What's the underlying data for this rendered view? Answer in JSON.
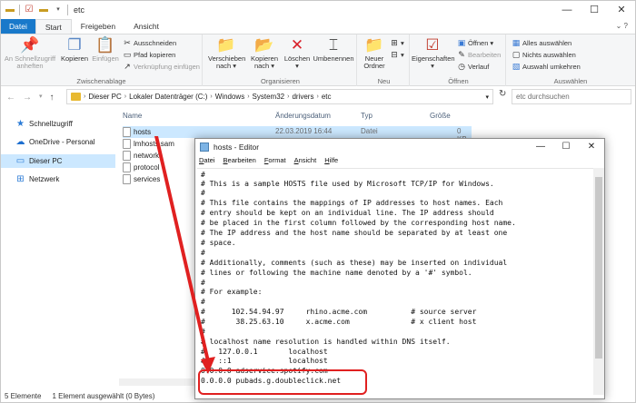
{
  "explorer": {
    "title": "etc",
    "tabs": [
      "Datei",
      "Start",
      "Freigeben",
      "Ansicht"
    ],
    "ribbon": {
      "clipboard": {
        "label": "Zwischenablage",
        "quick_access": "An Schnellzugriff anheften",
        "copy": "Kopieren",
        "paste": "Einfügen",
        "cut": "Ausschneiden",
        "copy_path": "Pfad kopieren",
        "paste_link": "Verknüpfung einfügen"
      },
      "organize": {
        "label": "Organisieren",
        "move_to": "Verschieben nach",
        "copy_to": "Kopieren nach",
        "delete": "Löschen",
        "rename": "Umbenennen"
      },
      "new": {
        "label": "Neu",
        "new_folder": "Neuer Ordner"
      },
      "open": {
        "label": "Öffnen",
        "properties": "Eigenschaften",
        "open": "Öffnen",
        "edit": "Bearbeiten",
        "history": "Verlauf"
      },
      "select": {
        "label": "Auswählen",
        "select_all": "Alles auswählen",
        "select_none": "Nichts auswählen",
        "invert": "Auswahl umkehren"
      }
    },
    "address": {
      "crumbs": [
        "Dieser PC",
        "Lokaler Datenträger (C:)",
        "Windows",
        "System32",
        "drivers",
        "etc"
      ],
      "search_placeholder": "etc durchsuchen"
    },
    "nav": {
      "quick_access": "Schnellzugriff",
      "onedrive": "OneDrive - Personal",
      "this_pc": "Dieser PC",
      "network": "Netzwerk"
    },
    "columns": {
      "name": "Name",
      "date": "Änderungsdatum",
      "type": "Typ",
      "size": "Größe"
    },
    "files": [
      {
        "name": "hosts",
        "date": "22.03.2019 16:44",
        "type": "Datei",
        "size": "0 KB"
      },
      {
        "name": "lmhosts.sam"
      },
      {
        "name": "networks"
      },
      {
        "name": "protocol"
      },
      {
        "name": "services"
      }
    ],
    "status": {
      "count": "5 Elemente",
      "selected": "1 Element ausgewählt (0 Bytes)"
    }
  },
  "notepad": {
    "title": "hosts - Editor",
    "menu": [
      "Datei",
      "Bearbeiten",
      "Format",
      "Ansicht",
      "Hilfe"
    ],
    "lines": [
      "#",
      "# This is a sample HOSTS file used by Microsoft TCP/IP for Windows.",
      "#",
      "# This file contains the mappings of IP addresses to host names. Each",
      "# entry should be kept on an individual line. The IP address should",
      "# be placed in the first column followed by the corresponding host name.",
      "# The IP address and the host name should be separated by at least one",
      "# space.",
      "#",
      "# Additionally, comments (such as these) may be inserted on individual",
      "# lines or following the machine name denoted by a '#' symbol.",
      "#",
      "# For example:",
      "#",
      "#      102.54.94.97     rhino.acme.com          # source server",
      "#       38.25.63.10     x.acme.com              # x client host",
      "#",
      "# localhost name resolution is handled within DNS itself.",
      "#   127.0.0.1       localhost",
      "#   ::1             localhost",
      "0.0.0.0 adservice.spotify.com",
      "0.0.0.0 pubads.g.doubleclick.net"
    ]
  }
}
